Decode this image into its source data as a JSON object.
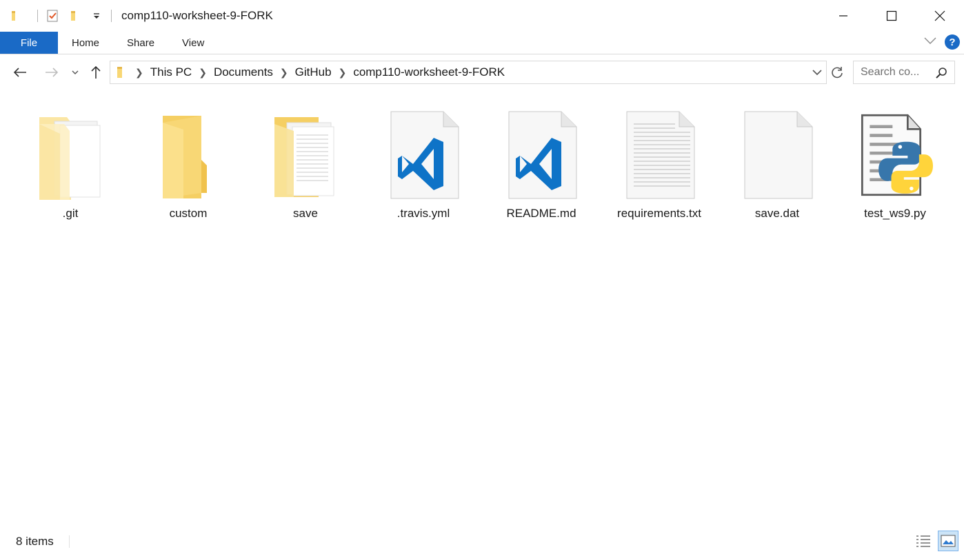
{
  "window": {
    "title": "comp110-worksheet-9-FORK"
  },
  "ribbon": {
    "tabs": [
      {
        "label": "File",
        "active": true
      },
      {
        "label": "Home"
      },
      {
        "label": "Share"
      },
      {
        "label": "View"
      }
    ],
    "help_label": "?"
  },
  "address": {
    "breadcrumbs": [
      "This PC",
      "Documents",
      "GitHub",
      "comp110-worksheet-9-FORK"
    ]
  },
  "search": {
    "placeholder": "Search co..."
  },
  "files": [
    {
      "name": ".git",
      "icon": "folder-with-files-icon"
    },
    {
      "name": "custom",
      "icon": "folder-icon"
    },
    {
      "name": "save",
      "icon": "folder-with-files-icon"
    },
    {
      "name": ".travis.yml",
      "icon": "vscode-file-icon"
    },
    {
      "name": "README.md",
      "icon": "vscode-file-icon"
    },
    {
      "name": "requirements.txt",
      "icon": "text-file-icon"
    },
    {
      "name": "save.dat",
      "icon": "blank-file-icon"
    },
    {
      "name": "test_ws9.py",
      "icon": "python-file-icon"
    }
  ],
  "status": {
    "item_count": "8 items"
  },
  "colors": {
    "accent": "#1a6ac6",
    "folder": "#f8d775",
    "vscode_blue": "#0e73c7"
  }
}
